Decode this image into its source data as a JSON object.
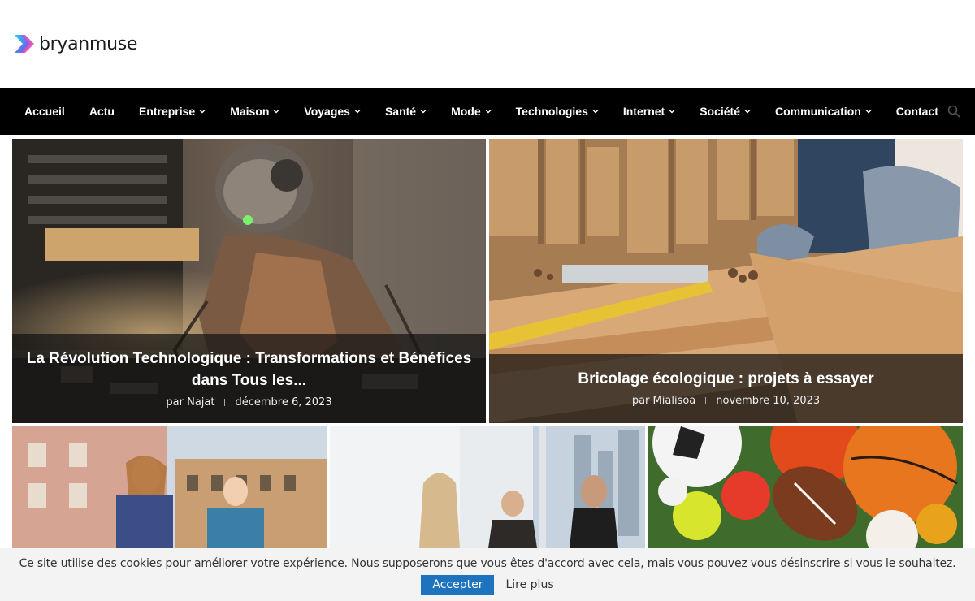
{
  "brand": {
    "name": "bryanmuse"
  },
  "nav": {
    "items": [
      {
        "label": "Accueil",
        "has_dropdown": false
      },
      {
        "label": "Actu",
        "has_dropdown": false
      },
      {
        "label": "Entreprise",
        "has_dropdown": true
      },
      {
        "label": "Maison",
        "has_dropdown": true
      },
      {
        "label": "Voyages",
        "has_dropdown": true
      },
      {
        "label": "Santé",
        "has_dropdown": true
      },
      {
        "label": "Mode",
        "has_dropdown": true
      },
      {
        "label": "Technologies",
        "has_dropdown": true
      },
      {
        "label": "Internet",
        "has_dropdown": true
      },
      {
        "label": "Société",
        "has_dropdown": true
      },
      {
        "label": "Communication",
        "has_dropdown": true
      },
      {
        "label": "Contact",
        "has_dropdown": false
      }
    ],
    "search_icon": "search-icon"
  },
  "featured": [
    {
      "title": "La Révolution Technologique : Transformations et Bénéfices dans Tous les...",
      "author": "par Najat",
      "date": "décembre 6, 2023"
    },
    {
      "title": "Bricolage écologique : projets à essayer",
      "author": "par Mialisoa",
      "date": "novembre 10, 2023"
    }
  ],
  "cookie": {
    "message": "Ce site utilise des cookies pour améliorer votre expérience. Nous supposerons que vous êtes d'accord avec cela, mais vous pouvez vous désinscrire si vous le souhaitez.",
    "accept_label": "Accepter",
    "more_label": "Lire plus"
  },
  "colors": {
    "nav_bg": "#000000",
    "accent": "#1e73be"
  }
}
